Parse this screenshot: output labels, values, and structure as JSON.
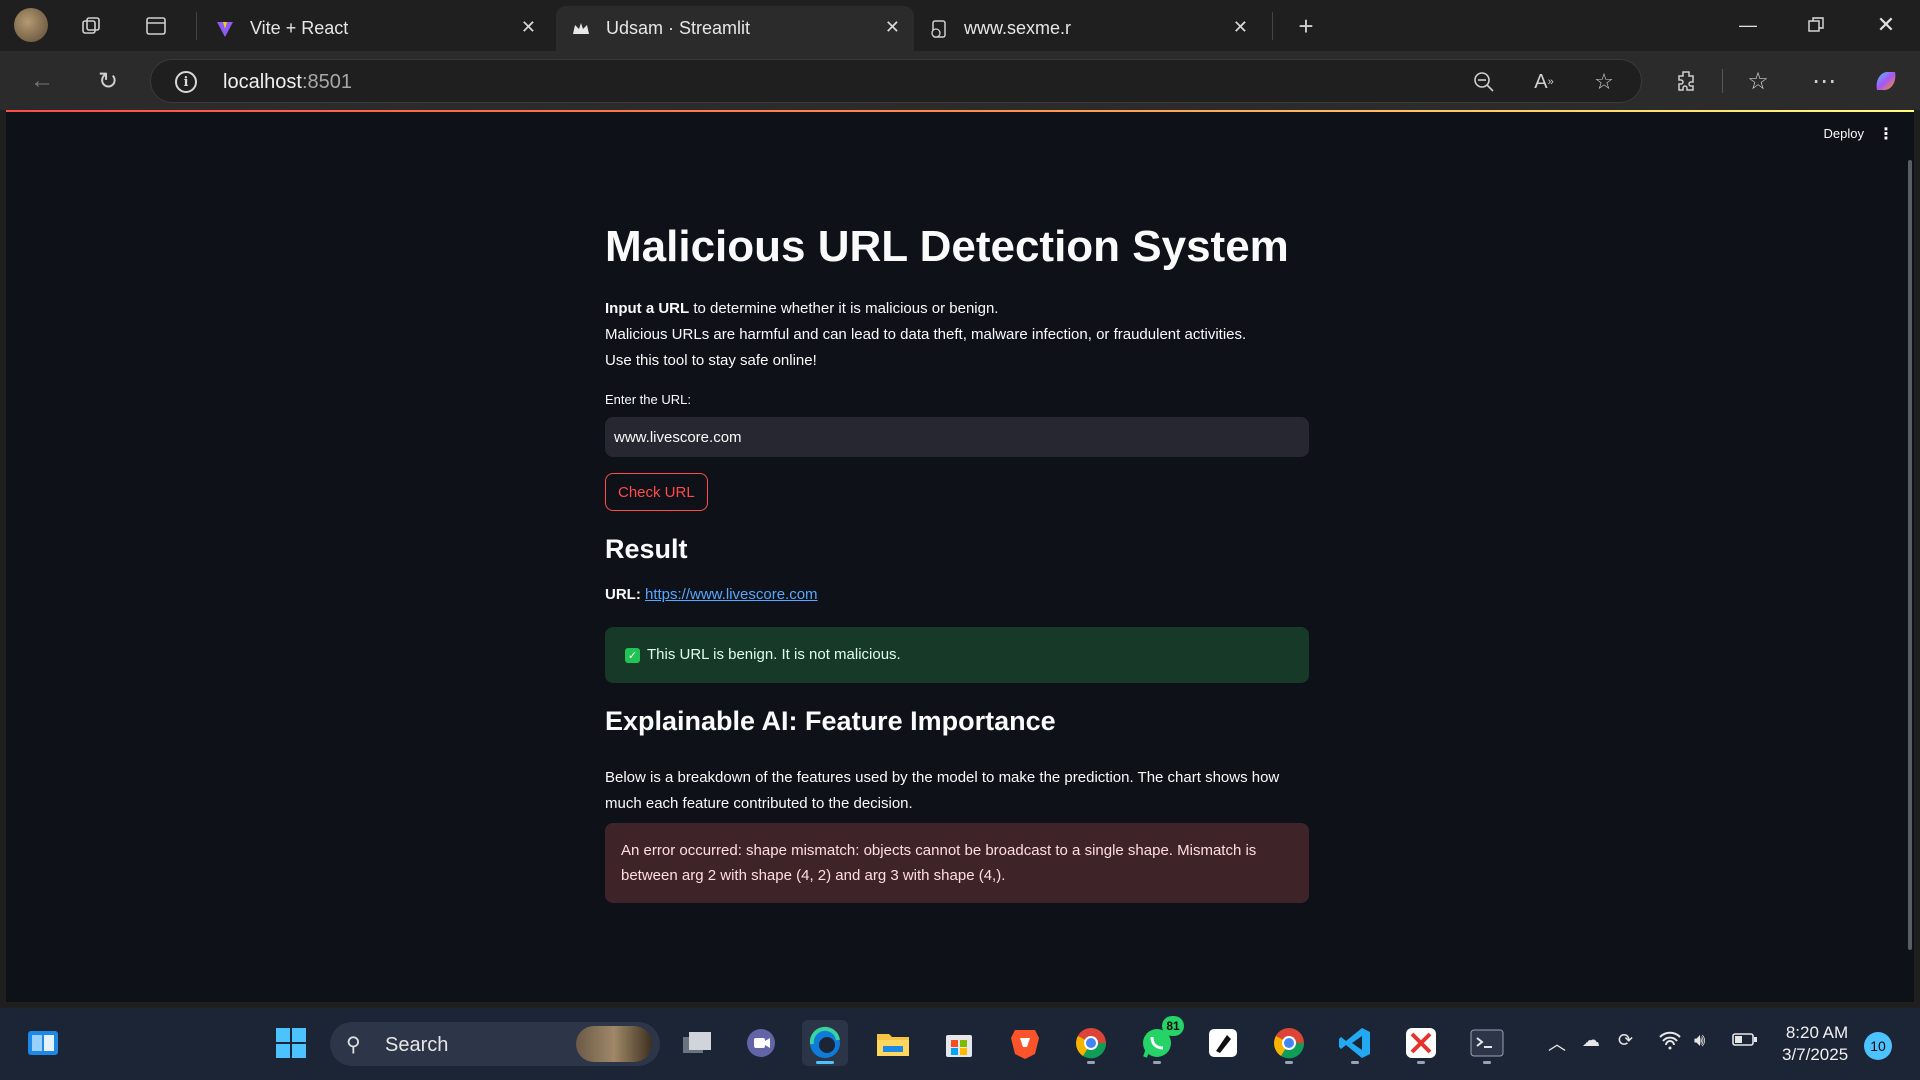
{
  "browser": {
    "tabs": [
      {
        "title": "Vite + React",
        "active": false
      },
      {
        "title": "Udsam · Streamlit",
        "active": true
      },
      {
        "title": "www.sexme.r",
        "active": false
      }
    ],
    "address": {
      "host": "localhost",
      "port": ":8501"
    }
  },
  "streamlit": {
    "deploy_label": "Deploy",
    "title": "Malicious URL Detection System",
    "intro_bold": "Input a URL",
    "intro_rest": " to determine whether it is malicious or benign.",
    "intro_line2": "Malicious URLs are harmful and can lead to data theft, malware infection, or fraudulent activities.",
    "intro_line3": "Use this tool to stay safe online!",
    "input_label": "Enter the URL:",
    "input_value": "www.livescore.com",
    "button_label": "Check URL",
    "result_heading": "Result",
    "result_url_label": "URL:",
    "result_url_link": "https://www.livescore.com",
    "success_message": "This URL is benign. It is not malicious.",
    "xai_heading": "Explainable AI: Feature Importance",
    "xai_line1": "Below is a breakdown of the features used by the model to make the prediction. The chart shows how",
    "xai_line2": "much each feature contributed to the decision.",
    "error_message": "An error occurred: shape mismatch: objects cannot be broadcast to a single shape. Mismatch is between arg 2 with shape (4, 2) and arg 3 with shape (4,)."
  },
  "taskbar": {
    "search_label": "Search",
    "whatsapp_badge": "81",
    "time": "8:20 AM",
    "date": "3/7/2025",
    "notifications": "10"
  },
  "colors": {
    "accent": "#ff4b4b",
    "success_bg": "#173928",
    "error_bg": "#3e2428",
    "page_bg": "#0e1117"
  }
}
